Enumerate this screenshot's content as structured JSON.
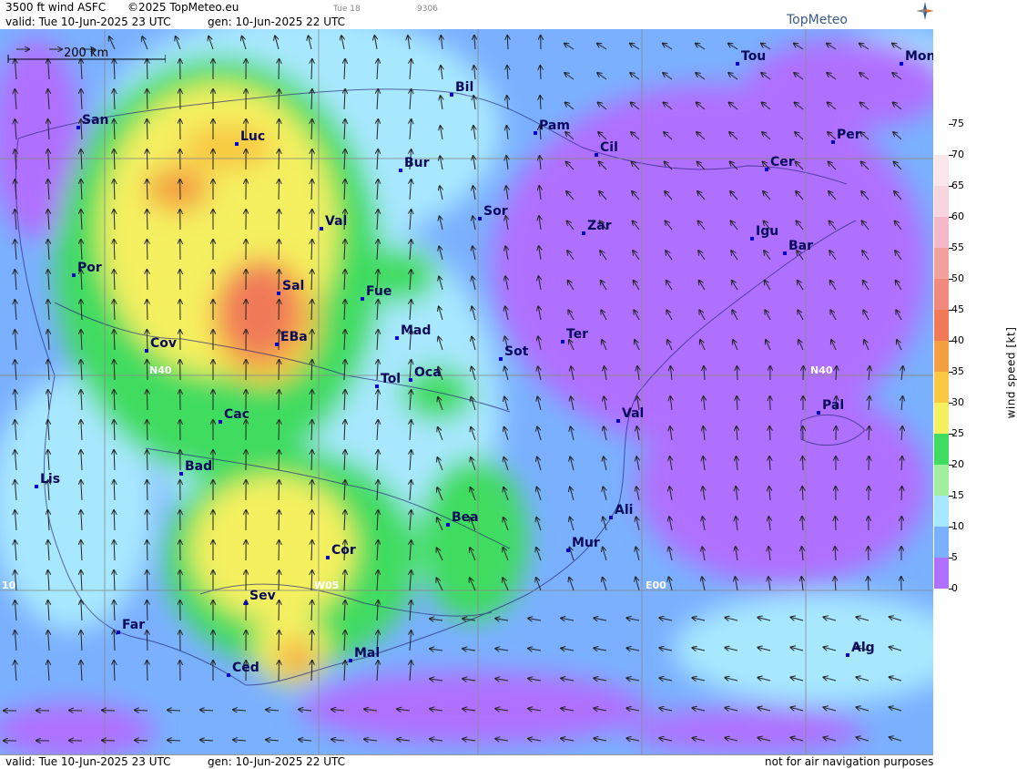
{
  "header": {
    "product": "3500 ft wind ASFC",
    "copyright": "©2025 TopMeteo.eu",
    "day_code": "Tue 18",
    "code": "9306",
    "valid": "valid:  Tue  10-Jun-2025  23 UTC",
    "gen": "gen: 10-Jun-2025 22 UTC",
    "brand": "TopMeteo"
  },
  "footer": {
    "valid": "valid:  Tue  10-Jun-2025  23 UTC",
    "gen": "gen: 10-Jun-2025 22 UTC",
    "disclaimer": "not for air navigation purposes"
  },
  "scale_bar": {
    "label": "200 km"
  },
  "grid_labels": [
    {
      "text": "N40"
    },
    {
      "text": "N40"
    },
    {
      "text": "W05"
    },
    {
      "text": "E00"
    },
    {
      "text": "10"
    }
  ],
  "cities": [
    {
      "name": "Tou"
    },
    {
      "name": "Mon"
    },
    {
      "name": "Bil"
    },
    {
      "name": "San"
    },
    {
      "name": "Luc"
    },
    {
      "name": "Pam"
    },
    {
      "name": "Cil"
    },
    {
      "name": "Per"
    },
    {
      "name": "Bur"
    },
    {
      "name": "Cer"
    },
    {
      "name": "Sor"
    },
    {
      "name": "Val"
    },
    {
      "name": "Zar"
    },
    {
      "name": "Igu"
    },
    {
      "name": "Bar"
    },
    {
      "name": "Por"
    },
    {
      "name": "Sal"
    },
    {
      "name": "Fue"
    },
    {
      "name": "Mad"
    },
    {
      "name": "Cov"
    },
    {
      "name": "EBa"
    },
    {
      "name": "Ter"
    },
    {
      "name": "Sot"
    },
    {
      "name": "Tol"
    },
    {
      "name": "Oca"
    },
    {
      "name": "Pal"
    },
    {
      "name": "Cac"
    },
    {
      "name": "Val"
    },
    {
      "name": "Bad"
    },
    {
      "name": "Lis"
    },
    {
      "name": "Ali"
    },
    {
      "name": "Bea"
    },
    {
      "name": "Mur"
    },
    {
      "name": "Cor"
    },
    {
      "name": "Sev"
    },
    {
      "name": "Far"
    },
    {
      "name": "Alg"
    },
    {
      "name": "Mal"
    },
    {
      "name": "Ced"
    }
  ],
  "legend": {
    "title": "wind speed [kt]",
    "ticks": [
      "75",
      "70",
      "65",
      "60",
      "55",
      "50",
      "45",
      "40",
      "35",
      "30",
      "25",
      "20",
      "15",
      "10",
      "5",
      "0"
    ],
    "colors": [
      "#ffffff",
      "#ffffff",
      "#fbe6ec",
      "#f8d4de",
      "#f5b8c8",
      "#f2a09c",
      "#f08a7c",
      "#f07a58",
      "#f4a040",
      "#f8c840",
      "#f4f060",
      "#40dc60",
      "#a0f0a0",
      "#a8e8ff",
      "#7ab0ff",
      "#b070ff"
    ]
  }
}
